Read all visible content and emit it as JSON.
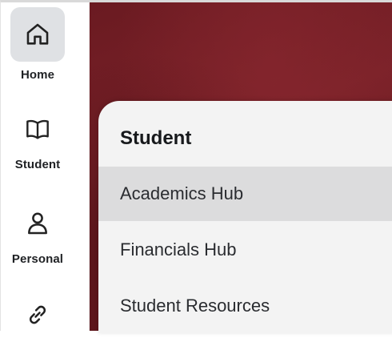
{
  "nav": {
    "items": [
      {
        "label": "Home",
        "icon": "home-icon",
        "active": true
      },
      {
        "label": "Student",
        "icon": "book-icon",
        "active": false
      },
      {
        "label": "Personal",
        "icon": "person-icon",
        "active": false
      },
      {
        "label": "",
        "icon": "link-icon",
        "active": false
      }
    ]
  },
  "menu": {
    "title": "Student",
    "items": [
      {
        "label": "Academics Hub",
        "highlighted": true
      },
      {
        "label": "Financials Hub",
        "highlighted": false
      },
      {
        "label": "Student Resources",
        "highlighted": false
      }
    ]
  },
  "colors": {
    "brand_maroon": "#6a1a21",
    "menu_background": "#f3f3f3",
    "active_nav_background": "#dfe1e4"
  }
}
